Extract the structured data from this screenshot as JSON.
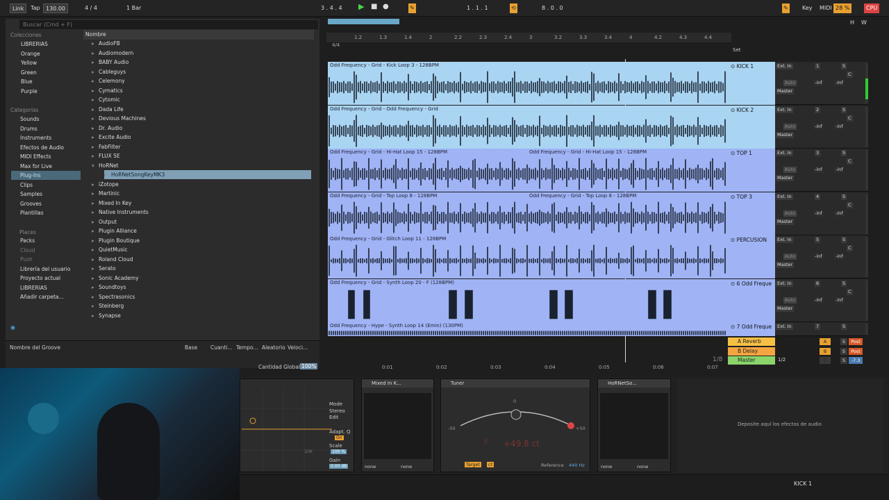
{
  "topbar": {
    "link": "Link",
    "tap": "Tap",
    "tempo": "130.00",
    "time_sig": "4 / 4",
    "quantize": "1 Bar",
    "position": "3 .  4 .  4",
    "loop_start": "1 .  1 .  1",
    "loop_length": "8 .  0 .  0",
    "key": "Key",
    "midi": "MIDI",
    "cpu_pct": "28 %",
    "cpu": "CPU"
  },
  "browser": {
    "search_placeholder": "Buscar (Cmd + F)",
    "collections_title": "Colecciones",
    "collections": [
      {
        "label": "LIBRERIAS",
        "color": "#e8473a"
      },
      {
        "label": "Orange",
        "color": "#f08a24"
      },
      {
        "label": "Yellow",
        "color": "#f3d23a"
      },
      {
        "label": "Green",
        "color": "#6ac84a"
      },
      {
        "label": "Blue",
        "color": "#3b8be0"
      },
      {
        "label": "Purple",
        "color": "#a55ee8"
      }
    ],
    "categories_title": "Categorías",
    "categories": [
      "Sounds",
      "Drums",
      "Instruments",
      "Efectos de Audio",
      "MIDI Effects",
      "Max for Live",
      "Plug-Ins",
      "Clips",
      "Samples",
      "Grooves",
      "Plantillas"
    ],
    "places_title": "Places",
    "places": [
      "Packs",
      "Cloud",
      "Push",
      "Librería del usuario",
      "Proyecto actual",
      "LIBRERIAS",
      "Añadir carpeta..."
    ],
    "name_header": "Nombre",
    "names": [
      "AudioFB",
      "Audiomodern",
      "BABY Audio",
      "Cableguys",
      "Celemony",
      "Cymatics",
      "Cytomic",
      "Dada Life",
      "Devious Machines",
      "Dr. Audio",
      "Excite Audio",
      "FabFilter",
      "FLUX SE",
      "HoRNet",
      "HoRNetSongKeyMK3",
      "iZotope",
      "Martinic",
      "Mixed In Key",
      "Native Instruments",
      "Output",
      "Plugin Alliance",
      "Plugin Boutique",
      "QuietMusic",
      "Roland Cloud",
      "Serato",
      "Sonic Academy",
      "Soundtoys",
      "Spectrasonics",
      "Steinberg",
      "Synapse"
    ]
  },
  "groove": {
    "name": "Nombre del Groove",
    "base": "Base",
    "cuant": "Cuanti...",
    "tempo": "Tempo...",
    "aleatorio": "Aleatorio",
    "veloc": "Veloci...",
    "global": "Cantidad Global",
    "global_val": "100%"
  },
  "ruler": {
    "ticks": [
      "1.2",
      "1.3",
      "1.4",
      "2",
      "2.2",
      "2.3",
      "2.4",
      "3",
      "3.2",
      "3.3",
      "3.4",
      "4",
      "4.2",
      "4.3",
      "4.4"
    ],
    "sig": "4/4",
    "set": "Set"
  },
  "timeline": {
    "ticks": [
      "0:01",
      "0:02",
      "0:03",
      "0:04",
      "0:05",
      "0:06",
      "0:07"
    ],
    "zoom": "1/8"
  },
  "tracks": [
    {
      "name": "KICK 1",
      "num": "1",
      "clip": "Odd Frequency - Grid - Kick Loop 3 - 128BPM",
      "color": "#a9d4f2",
      "namecolor": "#a9d4f2"
    },
    {
      "name": "KICK 2",
      "num": "2",
      "clip": "Odd Frequency - Grid - Odd Frequency - Grid",
      "color": "#a9d4f2",
      "namecolor": "#a9d4f2"
    },
    {
      "name": "TOP 1",
      "num": "3",
      "clip": "Odd Frequency - Grid - Hi-Hat Loop 15 - 128BPM",
      "clip2": "Odd Frequency - Grid - Hi-Hat Loop 15 - 128BPM",
      "color": "#9fb3f5",
      "namecolor": "#9fb3f5"
    },
    {
      "name": "TOP 3",
      "num": "4",
      "clip": "Odd Frequency - Grid - Top Loop 8 - 128BPM",
      "clip2": "Odd Frequency - Grid - Top Loop 8 - 128BPM",
      "color": "#9fb3f5",
      "namecolor": "#9fb3f5"
    },
    {
      "name": "PERCUSION",
      "num": "5",
      "clip": "Odd Frequency - Grid - Glitch Loop 11 - 128BPM",
      "color": "#9fb3f5",
      "namecolor": "#9fb3f5"
    },
    {
      "name": "6 Odd Freque",
      "num": "6",
      "clip": "Odd Frequency - Grid - Synth Loop 20 - F (128BPM)",
      "color": "#9fb3f5",
      "namecolor": "#9fb3f5"
    },
    {
      "name": "7 Odd Freque",
      "num": "7",
      "clip": "Odd Frequency - Hype - Synth Loop 14 (Emin) (130PM)",
      "color": "#9fb3f5",
      "namecolor": "#9fb3f5"
    }
  ],
  "returns": [
    {
      "name": "A Reverb",
      "letter": "A",
      "color": "#f5c044"
    },
    {
      "name": "B Delay",
      "letter": "B",
      "color": "#f5a540"
    },
    {
      "name": "Master",
      "letter": "0",
      "color": "#8ad46a"
    }
  ],
  "io": {
    "in": "Ext. In",
    "out": "Master",
    "auto": "Auto",
    "off": "Off",
    "inf": "-inf",
    "c": "C",
    "s": "S",
    "post": "Post",
    "half": "1/2",
    "master_val": "-7.3"
  },
  "devices": {
    "mode": "Mode",
    "stereo": "Stereo",
    "edit": "Edit",
    "adapt": "Adapt. Q",
    "on": "On",
    "scale": "Scale",
    "scale_val": "100 %",
    "gain": "Gain",
    "gain_val": "0.00 dB",
    "freq": "10k",
    "mixed_title": "Mixed In K...",
    "none": "none",
    "tuner_title": "Tuner",
    "tuner_zero": "0",
    "tuner_m50": "-50",
    "tuner_p50": "+50",
    "tuner_val": "+49.8 ct",
    "tuner_note": "E",
    "target": "Target",
    "ct": "ct",
    "reference": "Reference",
    "ref_val": "440 Hz",
    "hornet_title": "HoRNetSo...",
    "drop": "Deposite aquí los efectos de audio"
  },
  "statusbar": {
    "track": "KICK 1"
  }
}
